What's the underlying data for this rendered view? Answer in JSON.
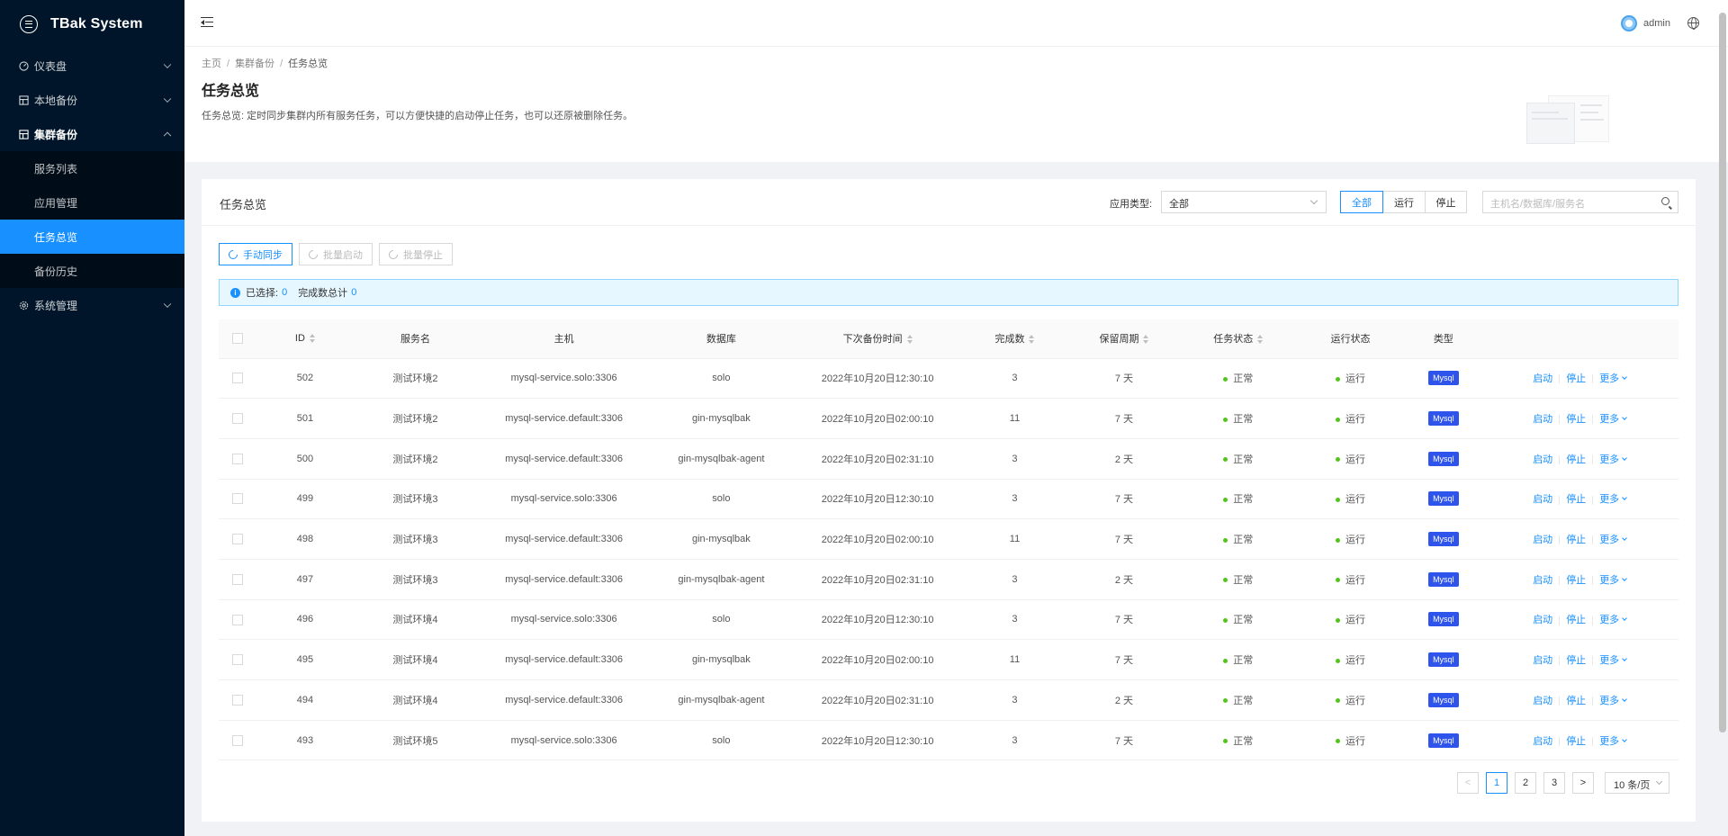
{
  "app": {
    "title": "TBak System"
  },
  "sidebar": {
    "items": [
      {
        "label": "仪表盘",
        "icon": "dashboard-icon"
      },
      {
        "label": "本地备份",
        "icon": "database-icon"
      },
      {
        "label": "集群备份",
        "icon": "cluster-icon",
        "open": true,
        "children": [
          {
            "label": "服务列表"
          },
          {
            "label": "应用管理"
          },
          {
            "label": "任务总览",
            "active": true
          },
          {
            "label": "备份历史"
          }
        ]
      },
      {
        "label": "系统管理",
        "icon": "gear-icon"
      }
    ]
  },
  "header": {
    "username": "admin"
  },
  "breadcrumb": [
    "主页",
    "集群备份",
    "任务总览"
  ],
  "page": {
    "title": "任务总览",
    "description": "任务总览: 定时同步集群内所有服务任务，可以方便快捷的启动停止任务，也可以还原被删除任务。"
  },
  "card": {
    "title": "任务总览",
    "filter_label": "应用类型:",
    "filter_value": "全部",
    "segments": [
      "全部",
      "运行",
      "停止"
    ],
    "search_placeholder": "主机名/数据库/服务名"
  },
  "toolbar": {
    "sync": "手动同步",
    "batch_start": "批量启动",
    "batch_stop": "批量停止"
  },
  "alert": {
    "selected_label": "已选择:",
    "selected_count": "0",
    "total_label": "完成数总计",
    "total_count": "0"
  },
  "table": {
    "columns": [
      "ID",
      "服务名",
      "主机",
      "数据库",
      "下次备份时间",
      "完成数",
      "保留周期",
      "任务状态",
      "运行状态",
      "类型"
    ],
    "actions": {
      "start": "启动",
      "stop": "停止",
      "more": "更多"
    },
    "rows": [
      {
        "id": "502",
        "service": "测试环境2",
        "host": "mysql-service.solo:3306",
        "db": "solo",
        "next": "2022年10月20日12:30:10",
        "done": "3",
        "retain": "7 天",
        "task": "正常",
        "run": "运行",
        "type": "Mysql"
      },
      {
        "id": "501",
        "service": "测试环境2",
        "host": "mysql-service.default:3306",
        "db": "gin-mysqlbak",
        "next": "2022年10月20日02:00:10",
        "done": "11",
        "retain": "7 天",
        "task": "正常",
        "run": "运行",
        "type": "Mysql"
      },
      {
        "id": "500",
        "service": "测试环境2",
        "host": "mysql-service.default:3306",
        "db": "gin-mysqlbak-agent",
        "next": "2022年10月20日02:31:10",
        "done": "3",
        "retain": "2 天",
        "task": "正常",
        "run": "运行",
        "type": "Mysql"
      },
      {
        "id": "499",
        "service": "测试环境3",
        "host": "mysql-service.solo:3306",
        "db": "solo",
        "next": "2022年10月20日12:30:10",
        "done": "3",
        "retain": "7 天",
        "task": "正常",
        "run": "运行",
        "type": "Mysql"
      },
      {
        "id": "498",
        "service": "测试环境3",
        "host": "mysql-service.default:3306",
        "db": "gin-mysqlbak",
        "next": "2022年10月20日02:00:10",
        "done": "11",
        "retain": "7 天",
        "task": "正常",
        "run": "运行",
        "type": "Mysql"
      },
      {
        "id": "497",
        "service": "测试环境3",
        "host": "mysql-service.default:3306",
        "db": "gin-mysqlbak-agent",
        "next": "2022年10月20日02:31:10",
        "done": "3",
        "retain": "2 天",
        "task": "正常",
        "run": "运行",
        "type": "Mysql"
      },
      {
        "id": "496",
        "service": "测试环境4",
        "host": "mysql-service.solo:3306",
        "db": "solo",
        "next": "2022年10月20日12:30:10",
        "done": "3",
        "retain": "7 天",
        "task": "正常",
        "run": "运行",
        "type": "Mysql"
      },
      {
        "id": "495",
        "service": "测试环境4",
        "host": "mysql-service.default:3306",
        "db": "gin-mysqlbak",
        "next": "2022年10月20日02:00:10",
        "done": "11",
        "retain": "7 天",
        "task": "正常",
        "run": "运行",
        "type": "Mysql"
      },
      {
        "id": "494",
        "service": "测试环境4",
        "host": "mysql-service.default:3306",
        "db": "gin-mysqlbak-agent",
        "next": "2022年10月20日02:31:10",
        "done": "3",
        "retain": "2 天",
        "task": "正常",
        "run": "运行",
        "type": "Mysql"
      },
      {
        "id": "493",
        "service": "测试环境5",
        "host": "mysql-service.solo:3306",
        "db": "solo",
        "next": "2022年10月20日12:30:10",
        "done": "3",
        "retain": "7 天",
        "task": "正常",
        "run": "运行",
        "type": "Mysql"
      }
    ]
  },
  "pagination": {
    "prev": "<",
    "pages": [
      "1",
      "2",
      "3"
    ],
    "current": "1",
    "next": ">",
    "page_size": "10 条/页"
  },
  "colors": {
    "sidebar_bg": "#001529",
    "accent": "#1890ff",
    "tag": "#2f54eb",
    "status_ok": "#52c41a"
  }
}
